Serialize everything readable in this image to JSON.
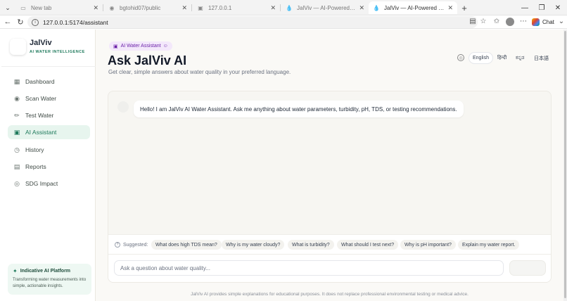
{
  "browser": {
    "tabs": [
      {
        "title": "New tab",
        "icon": "new-tab-page-icon",
        "active": false
      },
      {
        "title": "bgtohid07/public",
        "icon": "github-icon",
        "active": false
      },
      {
        "title": "127.0.0.1",
        "icon": "page-icon",
        "active": false
      },
      {
        "title": "JalViv — AI-Powered Water Intellig",
        "icon": "water-drop-icon",
        "active": false
      },
      {
        "title": "JalViv — AI-Powered Water Intellig",
        "icon": "water-drop-icon",
        "active": true
      }
    ],
    "url": "127.0.0.1:5174/assistant",
    "chat_label": "Chat"
  },
  "sidebar": {
    "brand_name": "JalViv",
    "brand_tagline": "AI WATER INTELLIGENCE",
    "items": [
      {
        "label": "Dashboard",
        "icon": "grid-icon",
        "active": false
      },
      {
        "label": "Scan Water",
        "icon": "camera-icon",
        "active": false
      },
      {
        "label": "Test Water",
        "icon": "test-tube-icon",
        "active": false
      },
      {
        "label": "AI Assistant",
        "icon": "bot-icon",
        "active": true
      },
      {
        "label": "History",
        "icon": "clock-icon",
        "active": false
      },
      {
        "label": "Reports",
        "icon": "document-icon",
        "active": false
      },
      {
        "label": "SDG Impact",
        "icon": "target-icon",
        "active": false
      }
    ],
    "card": {
      "title": "Indicative AI Platform",
      "description": "Transforming water measurements into simple, actionable insights."
    }
  },
  "header": {
    "badge": "AI Water Assistant",
    "title": "Ask JalViv AI",
    "subtitle": "Get clear, simple answers about water quality in your preferred language.",
    "languages": [
      "English",
      "हिन्दी",
      "ಕನ್ನಡ",
      "日本語"
    ],
    "active_language": "English"
  },
  "chat": {
    "messages": [
      {
        "role": "assistant",
        "text": "Hello! I am JalViv AI Water Assistant. Ask me anything about water parameters, turbidity, pH, TDS, or testing recommendations."
      }
    ],
    "suggested_label": "Suggested:",
    "suggestions": [
      "What does high TDS mean?",
      "Why is my water cloudy?",
      "What is turbidity?",
      "What should I test next?",
      "Why is pH important?",
      "Explain my water report."
    ],
    "input_placeholder": "Ask a question about water quality...",
    "input_value": ""
  },
  "footer": {
    "disclaimer": "JalViv AI provides simple explanations for educational purposes. It does not replace professional environmental testing or medical advice."
  },
  "colors": {
    "accent": "#1f7a5c",
    "active_nav_bg": "#e7f5ee",
    "badge_bg": "#f3e8fb",
    "badge_text": "#6b21a8",
    "page_bg": "#faf9f6"
  }
}
